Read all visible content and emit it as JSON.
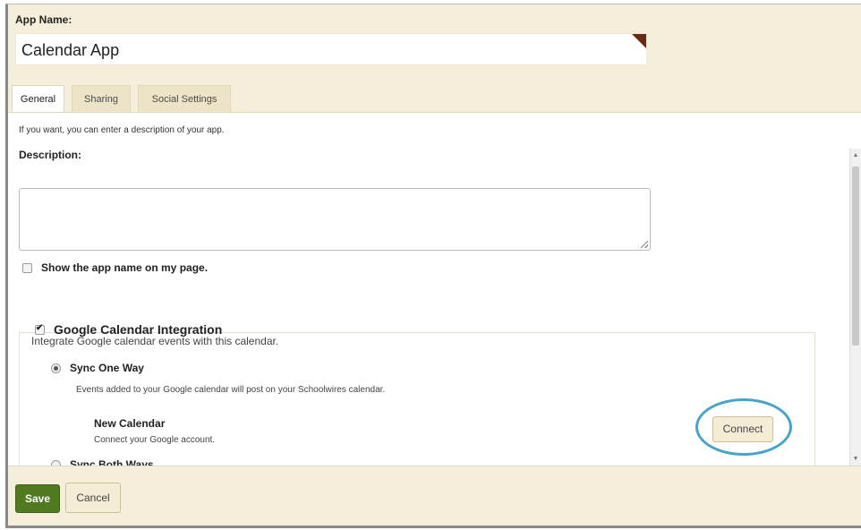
{
  "app_name": {
    "label": "App Name:",
    "value": "Calendar App"
  },
  "tabs": [
    {
      "label": "General",
      "active": true
    },
    {
      "label": "Sharing",
      "active": false
    },
    {
      "label": "Social Settings",
      "active": false
    }
  ],
  "general": {
    "intro": "If you want, you can enter a description of your app.",
    "description_label": "Description:",
    "description_value": "",
    "show_name_label": "Show the app name on my page.",
    "show_name_checked": false
  },
  "google": {
    "title": "Google Calendar Integration",
    "checked": true,
    "description": "Integrate Google calendar events with this calendar.",
    "sync_one_way": {
      "label": "Sync One Way",
      "selected": true,
      "description": "Events added to your Google calendar will post on your Schoolwires calendar."
    },
    "new_calendar": {
      "title": "New Calendar",
      "subtitle": "Connect your Google account."
    },
    "connect_label": "Connect",
    "sync_both_ways": {
      "label": "Sync Both Ways",
      "selected": false
    }
  },
  "footer": {
    "save_label": "Save",
    "cancel_label": "Cancel"
  },
  "colors": {
    "panel_bg": "#f5eedb",
    "save_green": "#4f7a1f",
    "highlight_blue": "#4aa3c7",
    "corner_brown": "#6b2a12"
  }
}
